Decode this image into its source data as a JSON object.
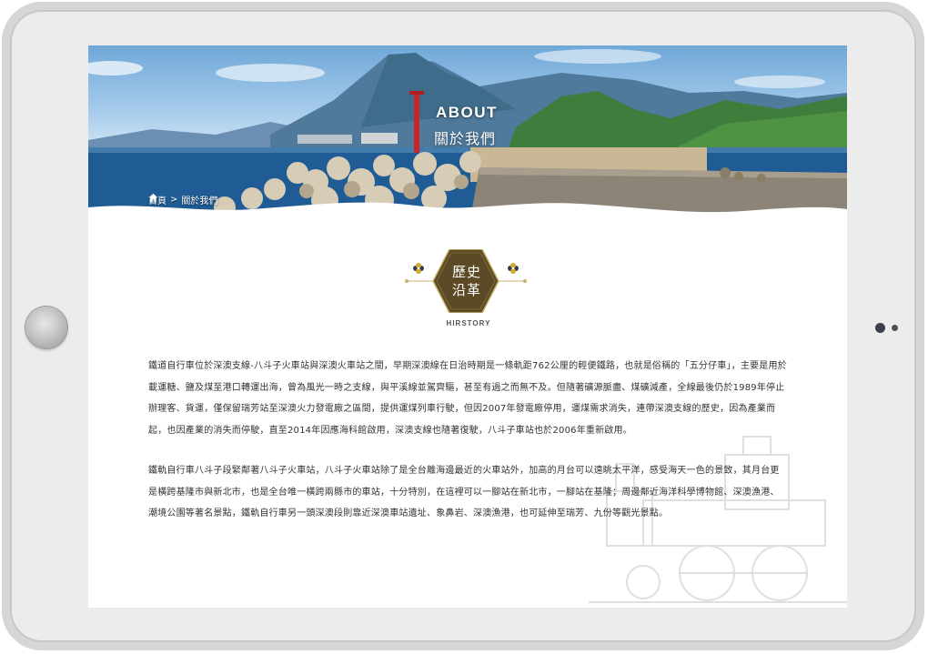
{
  "header": {
    "title_en": "ABOUT",
    "title_zh": "關於我們"
  },
  "breadcrumb": {
    "home": "首頁",
    "separator": ">",
    "current": "關於我們"
  },
  "section": {
    "badge_line1": "歷史",
    "badge_line2": "沿革",
    "label": "HIRSTORY"
  },
  "paragraphs": [
    "鐵道自行車位於深澳支線-八斗子火車站與深澳火車站之間，早期深澳線在日治時期是一條軌距762公厘的輕便鐵路，也就是俗稱的「五分仔車」，主要是用於載運糖、鹽及煤至港口轉運出海，曾為風光一時之支線，與平溪線並駕齊驅，甚至有過之而無不及。但隨著礦源脈盡、煤礦減產，全線最後仍於1989年停止辦理客、貨運，僅保留瑞芳站至深澳火力發電廠之區間，提供運煤列車行駛，但因2007年發電廠停用，運煤需求消失，連帶深澳支線的歷史，因為產業而起，也因產業的消失而停駛，直至2014年因應海科館啟用，深澳支線也隨著復駛，八斗子車站也於2006年重新啟用。",
    "鐵軌自行車八斗子段緊鄰著八斗子火車站，八斗子火車站除了是全台離海邊最近的火車站外，加高的月台可以遠眺太平洋，感受海天一色的景致，其月台更是橫跨基隆市與新北市，也是全台唯一橫跨兩縣市的車站，十分特別，在這裡可以一腳站在新北市，一腳站在基隆；周邊鄰近海洋科學博物館、深澳漁港、潮境公園等著名景點，鐵軌自行車另一頭深澳段則靠近深澳車站遺址、象鼻岩、深澳漁港，也可延伸至瑞芳、九份等觀光景點。"
  ],
  "colors": {
    "badge_fill": "#5b4a25",
    "badge_stroke": "#c9b06a",
    "text": "#333333"
  },
  "icons": {
    "home": "home-icon",
    "flower": "flower-icon",
    "train": "train-illustration"
  }
}
